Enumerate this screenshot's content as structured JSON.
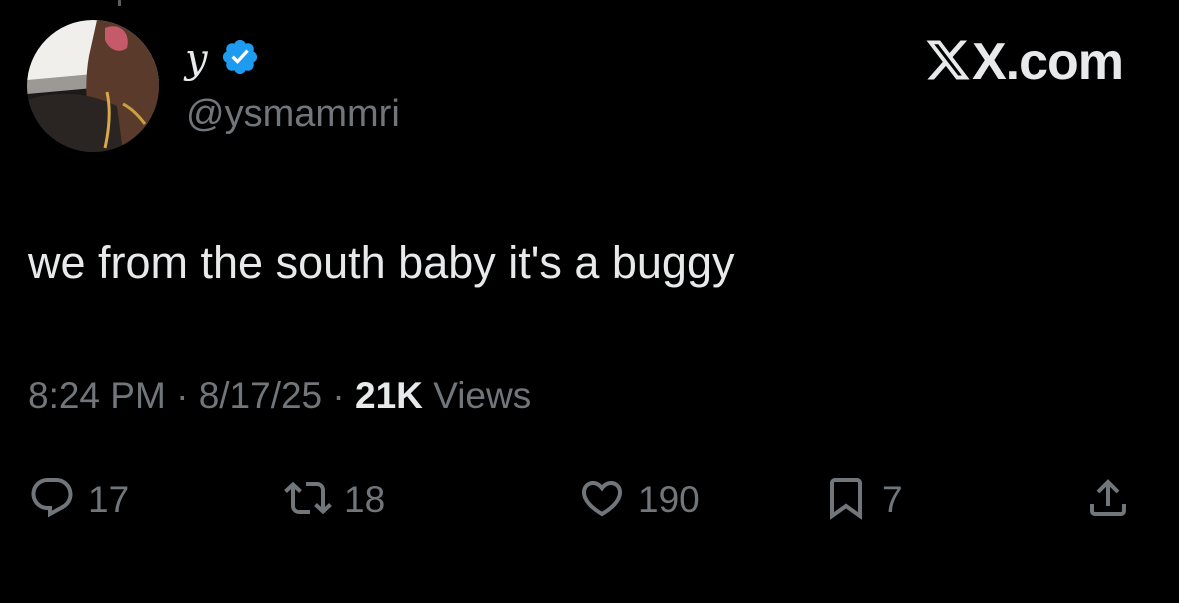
{
  "tweet": {
    "author": {
      "display_name": "y",
      "handle": "@ysmammri",
      "verified": true
    },
    "brand": {
      "label": "X.com"
    },
    "text": "we from the south baby it's a buggy",
    "meta": {
      "time": "8:24 PM",
      "separator": " · ",
      "date": "8/17/25",
      "views_count": "21K",
      "views_label": "Views"
    },
    "actions": {
      "replies": "17",
      "retweets": "18",
      "likes": "190",
      "bookmarks": "7"
    }
  },
  "colors": {
    "background": "#000000",
    "primary_text": "#e7e9ea",
    "secondary_text": "#71767b",
    "verified_badge": "#1d9bf0"
  },
  "icons": [
    "verified-badge-icon",
    "x-logo-icon",
    "reply-icon",
    "retweet-icon",
    "like-icon",
    "bookmark-icon",
    "share-icon"
  ]
}
